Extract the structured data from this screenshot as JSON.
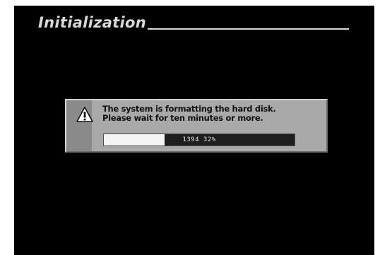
{
  "header": {
    "title": "Initialization"
  },
  "dialog": {
    "icon": "warning-icon",
    "message_line1": "The system is formatting the hard disk.",
    "message_line2": "Please wait for ten minutes or more.",
    "progress": {
      "fraction": 0.32,
      "label": "1394 32%"
    }
  },
  "colors": {
    "screen_background": "#000000",
    "title_text": "#d8d8d8",
    "dialog_background": "#a9a9a9",
    "progress_fill": "#f4f4f4",
    "progress_track": "#1e1e1e"
  }
}
